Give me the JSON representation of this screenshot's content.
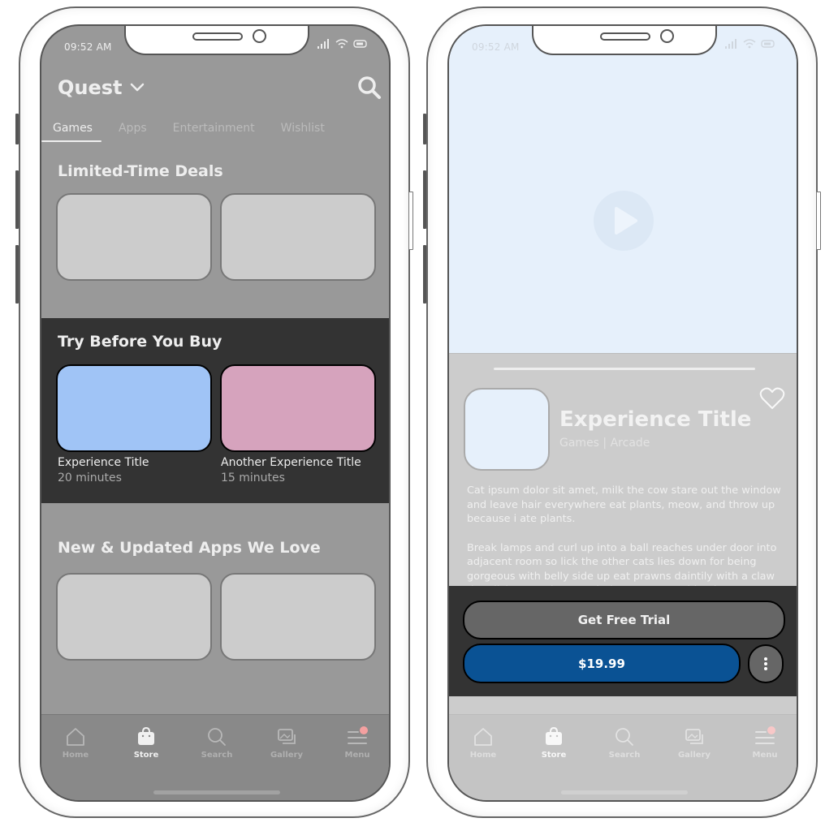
{
  "status_bar": {
    "time": "09:52 AM"
  },
  "left_screen": {
    "header": {
      "title": "Quest"
    },
    "tabs": [
      {
        "label": "Games",
        "active": true
      },
      {
        "label": "Apps",
        "active": false
      },
      {
        "label": "Entertainment",
        "active": false
      },
      {
        "label": "Wishlist",
        "active": false
      }
    ],
    "sections": {
      "deals": {
        "title": "Limited-Time Deals"
      },
      "try": {
        "title": "Try Before You Buy",
        "items": [
          {
            "title": "Experience Title",
            "duration": "20 minutes",
            "color": "#a0c4f6"
          },
          {
            "title": "Another Experience Title",
            "duration": "15 minutes",
            "color": "#d6a3bd"
          }
        ]
      },
      "new_apps": {
        "title": "New & Updated Apps We Love"
      }
    }
  },
  "right_screen": {
    "experience": {
      "title": "Experience Title",
      "category": "Games | Arcade",
      "description": [
        "Cat ipsum dolor sit amet, milk the cow stare out the window and leave hair everywhere eat plants, meow, and throw up because i ate plants.",
        "Break lamps and curl up into a ball reaches under door into adjacent room so lick the other cats lies down for being gorgeous with belly side up eat prawns daintily with a claw then lick paws clean wash down prawns with a lap"
      ]
    },
    "actions": {
      "trial_label": "Get Free Trial",
      "price_label": "$19.99"
    }
  },
  "tabbar": {
    "items": [
      {
        "label": "Home",
        "icon": "home-icon"
      },
      {
        "label": "Store",
        "icon": "store-icon",
        "active": true
      },
      {
        "label": "Search",
        "icon": "search-icon"
      },
      {
        "label": "Gallery",
        "icon": "gallery-icon"
      },
      {
        "label": "Menu",
        "icon": "menu-icon",
        "badge": true
      }
    ]
  },
  "colors": {
    "accent_blue": "#0a5294",
    "notification_badge": "#f4a0a0"
  }
}
